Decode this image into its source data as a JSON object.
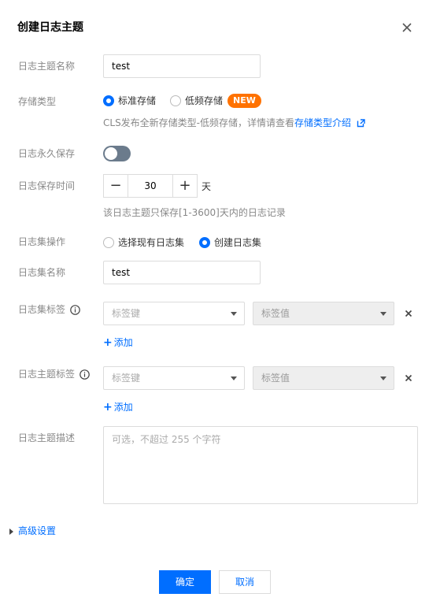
{
  "dialog": {
    "title": "创建日志主题"
  },
  "topic_name": {
    "label": "日志主题名称",
    "value": "test"
  },
  "storage_type": {
    "label": "存储类型",
    "options": [
      {
        "label": "标准存储",
        "selected": true
      },
      {
        "label": "低频存储",
        "selected": false
      }
    ],
    "new_badge": "NEW",
    "hint": "CLS发布全新存储类型-低频存储，详情请查看",
    "hint_link": "存储类型介绍"
  },
  "permanent": {
    "label": "日志永久保存",
    "enabled": false
  },
  "retention": {
    "label": "日志保存时间",
    "minus": "−",
    "value": "30",
    "plus": "+",
    "unit": "天",
    "hint": "该日志主题只保存[1-3600]天内的日志记录"
  },
  "logset_action": {
    "label": "日志集操作",
    "options": [
      {
        "label": "选择现有日志集",
        "selected": false
      },
      {
        "label": "创建日志集",
        "selected": true
      }
    ]
  },
  "logset_name": {
    "label": "日志集名称",
    "value": "test"
  },
  "logset_tags": {
    "label": "日志集标签",
    "key_placeholder": "标签键",
    "value_placeholder": "标签值",
    "add": "添加"
  },
  "topic_tags": {
    "label": "日志主题标签",
    "key_placeholder": "标签键",
    "value_placeholder": "标签值",
    "add": "添加"
  },
  "description": {
    "label": "日志主题描述",
    "placeholder": "可选，不超过 255 个字符"
  },
  "advanced": {
    "label": "高级设置"
  },
  "footer": {
    "confirm": "确定",
    "cancel": "取消"
  },
  "colors": {
    "accent": "#006eff",
    "new_badge": "#ff7200",
    "toggle_off": "#6b7b8c"
  }
}
